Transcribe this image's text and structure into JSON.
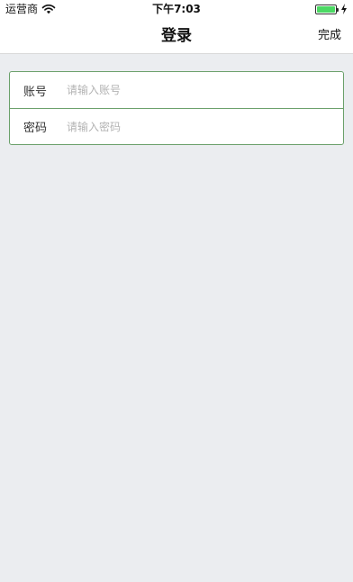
{
  "status_bar": {
    "carrier": "运营商",
    "time": "下午7:03",
    "battery_level": 1.0,
    "wifi_icon": "wifi-icon",
    "battery_icon": "battery-icon",
    "charging_icon": "charging-bolt-icon"
  },
  "nav": {
    "title": "登录",
    "done_label": "完成"
  },
  "form": {
    "account": {
      "label": "账号",
      "placeholder": "请输入账号",
      "value": ""
    },
    "password": {
      "label": "密码",
      "placeholder": "请输入密码",
      "value": ""
    }
  },
  "colors": {
    "background": "#ebedf0",
    "border_accent": "#6aa06a",
    "battery_green": "#4cd964",
    "placeholder": "#b3b3b3"
  }
}
